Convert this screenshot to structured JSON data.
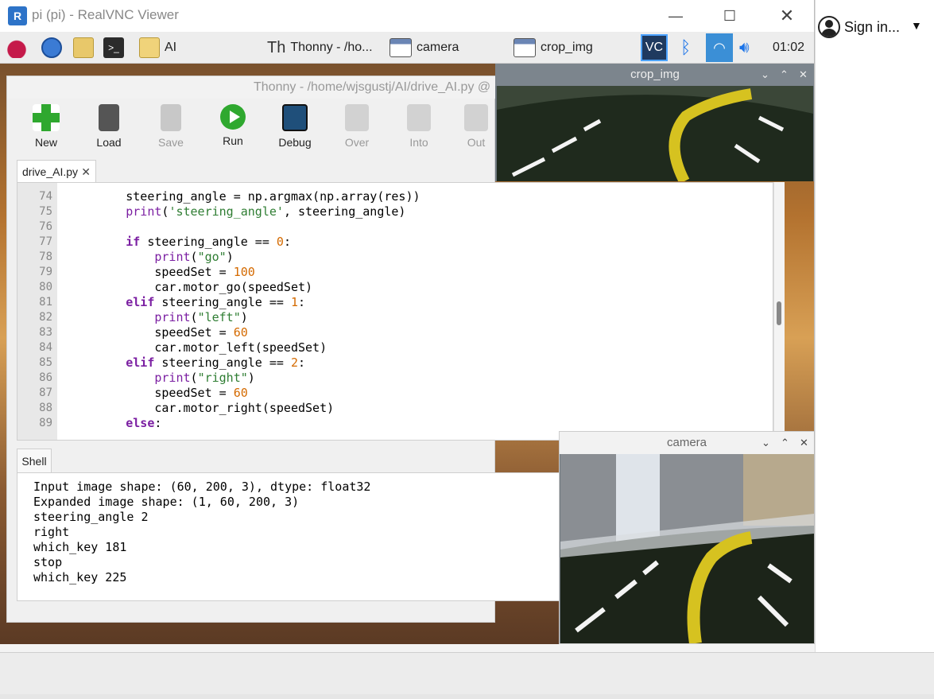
{
  "vnc": {
    "title": "pi (pi) - RealVNC Viewer",
    "logo": "R"
  },
  "host": {
    "sign_in": "Sign in...",
    "avatar_icon": "user-avatar-icon"
  },
  "taskbar": {
    "folder_label": "AI",
    "thonny_task": "Thonny  -  /ho...",
    "camera_task": "camera",
    "crop_task": "crop_img",
    "clock": "01:02"
  },
  "thonny": {
    "title": "Thonny  -  /home/wjsgustj/AI/drive_AI.py  @",
    "toolbar": [
      {
        "label": "New",
        "enabled": true
      },
      {
        "label": "Load",
        "enabled": true
      },
      {
        "label": "Save",
        "enabled": false
      },
      {
        "label": "Run",
        "enabled": true
      },
      {
        "label": "Debug",
        "enabled": true
      },
      {
        "label": "Over",
        "enabled": false
      },
      {
        "label": "Into",
        "enabled": false
      },
      {
        "label": "Out",
        "enabled": false
      }
    ],
    "file_tab": "drive_AI.py",
    "shell_tab": "Shell"
  },
  "editor": {
    "lines": [
      {
        "n": "74",
        "text": "        steering_angle = np.argmax(np.array(res))"
      },
      {
        "n": "75",
        "text": "        print('steering_angle', steering_angle)"
      },
      {
        "n": "76",
        "text": ""
      },
      {
        "n": "77",
        "text": "        if steering_angle == 0:"
      },
      {
        "n": "78",
        "text": "            print(\"go\")"
      },
      {
        "n": "79",
        "text": "            speedSet = 100"
      },
      {
        "n": "80",
        "text": "            car.motor_go(speedSet)"
      },
      {
        "n": "81",
        "text": "        elif steering_angle == 1:"
      },
      {
        "n": "82",
        "text": "            print(\"left\")"
      },
      {
        "n": "83",
        "text": "            speedSet = 60"
      },
      {
        "n": "84",
        "text": "            car.motor_left(speedSet)"
      },
      {
        "n": "85",
        "text": "        elif steering_angle == 2:"
      },
      {
        "n": "86",
        "text": "            print(\"right\")"
      },
      {
        "n": "87",
        "text": "            speedSet = 60"
      },
      {
        "n": "88",
        "text": "            car.motor_right(speedSet)"
      },
      {
        "n": "89",
        "text": "        else:"
      }
    ]
  },
  "shell": {
    "lines": [
      "Input image shape: (60, 200, 3), dtype: float32",
      "Expanded image shape: (1, 60, 200, 3)",
      "steering_angle 2",
      "right",
      "which_key 181",
      "stop",
      "which_key 225"
    ]
  },
  "windows": {
    "crop_img": "crop_img",
    "camera": "camera"
  },
  "colors": {
    "keyword": "#7b1fa2",
    "string": "#2e7d32",
    "number": "#d46a00"
  }
}
